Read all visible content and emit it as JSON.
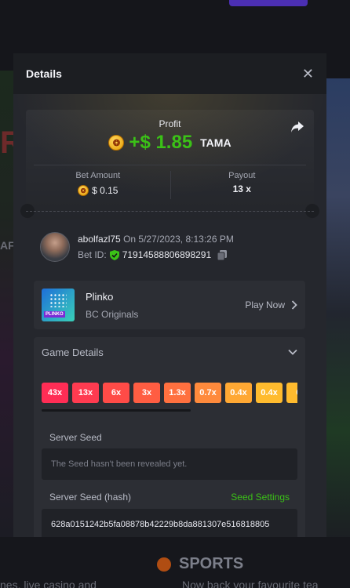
{
  "background": {
    "left_text": "R",
    "left_partial": "AF",
    "bottom_left": "nes, live casino and",
    "sports_title": "SPORTS",
    "sports_sub": "Now back your favourite tea"
  },
  "modal": {
    "title": "Details",
    "close_icon": "close-icon",
    "profit": {
      "label": "Profit",
      "amount": "+$ 1.85",
      "currency": "TAMA"
    },
    "bet_amount": {
      "label": "Bet Amount",
      "value": "$ 0.15"
    },
    "payout": {
      "label": "Payout",
      "value": "13 x"
    },
    "user": {
      "name": "abolfazl75",
      "timestamp": "On 5/27/2023, 8:13:26 PM",
      "bet_id_label": "Bet ID:",
      "bet_id": "71914588806898291"
    },
    "game": {
      "name": "Plinko",
      "provider": "BC Originals",
      "play_label": "Play Now",
      "thumb_badge": "PLINKO"
    },
    "game_details": {
      "title": "Game Details",
      "multipliers": [
        {
          "label": "43x",
          "color": "#ff2d55"
        },
        {
          "label": "13x",
          "color": "#ff3b50"
        },
        {
          "label": "6x",
          "color": "#ff4b47"
        },
        {
          "label": "3x",
          "color": "#ff5d42"
        },
        {
          "label": "1.3x",
          "color": "#ff703f"
        },
        {
          "label": "0.7x",
          "color": "#ff8a3c"
        },
        {
          "label": "0.4x",
          "color": "#ffa833"
        },
        {
          "label": "0.4x",
          "color": "#ffbb2e"
        },
        {
          "label": "0.",
          "color": "#ffbb2e"
        }
      ],
      "server_seed_label": "Server Seed",
      "server_seed_placeholder": "The Seed hasn't been revealed yet.",
      "server_seed_hash_label": "Server Seed (hash)",
      "seed_settings_label": "Seed Settings",
      "server_seed_hash": "628a0151242b5fa08878b42229b8da881307e516818805"
    }
  },
  "colors": {
    "accent_green": "#3bc117",
    "modal_bg": "#25272d",
    "header_bg": "#1c1e22"
  }
}
